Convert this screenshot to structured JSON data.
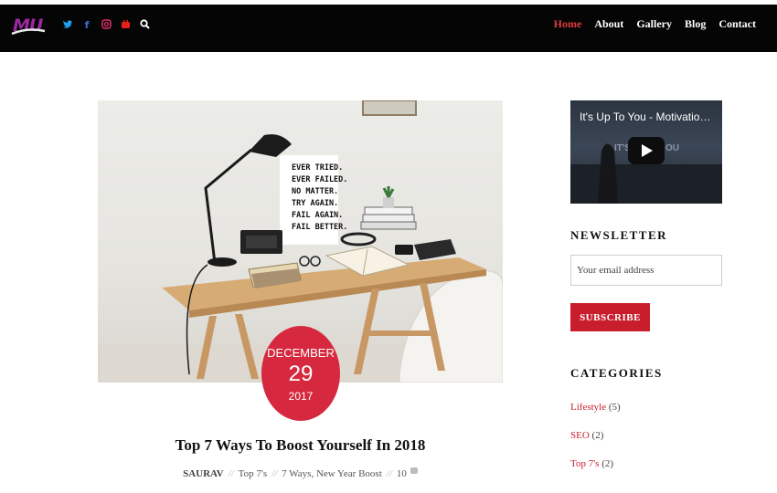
{
  "header": {
    "logo_text": "MU",
    "social_icons": [
      "twitter-icon",
      "facebook-icon",
      "instagram-icon",
      "youtube-icon",
      "search-icon"
    ],
    "nav": [
      {
        "label": "Home",
        "active": true
      },
      {
        "label": "About",
        "active": false
      },
      {
        "label": "Gallery",
        "active": false
      },
      {
        "label": "Blog",
        "active": false
      },
      {
        "label": "Contact",
        "active": false
      }
    ]
  },
  "post": {
    "image_poster_lines": [
      "EVER TRIED.",
      "EVER FAILED.",
      "NO MATTER.",
      "TRY AGAIN.",
      "FAIL AGAIN.",
      "FAIL BETTER."
    ],
    "date": {
      "month": "DECEMBER",
      "day": "29",
      "year": "2017"
    },
    "title": "Top 7 Ways To Boost Yourself In 2018",
    "meta": {
      "author": "SAURAV",
      "category": "Top 7's",
      "tags": "7 Ways, New Year Boost",
      "comments": "10"
    }
  },
  "sidebar": {
    "video_title": "It's Up To You - Motivational...",
    "newsletter": {
      "heading": "NEWSLETTER",
      "placeholder": "Your email address",
      "button": "SUBSCRIBE"
    },
    "categories": {
      "heading": "CATEGORIES",
      "items": [
        {
          "name": "Lifestyle",
          "count": "(5)"
        },
        {
          "name": "SEO",
          "count": "(2)"
        },
        {
          "name": "Top 7's",
          "count": "(2)"
        }
      ]
    }
  },
  "colors": {
    "accent": "#c81e2c",
    "badge": "#d6293f",
    "header_bg": "#050505",
    "nav_active": "#e23a3a"
  }
}
